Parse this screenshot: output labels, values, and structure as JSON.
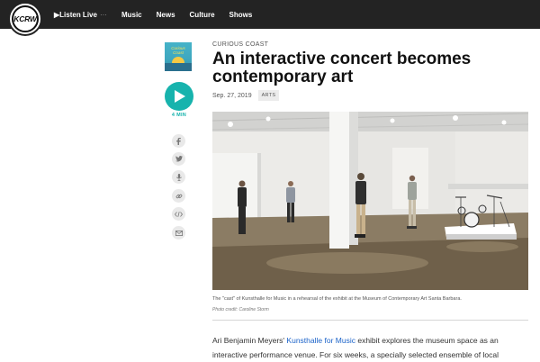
{
  "nav": {
    "logo_text": "KCRW",
    "listen_label": "▶Listen Live",
    "listen_more": "···",
    "items": [
      "Music",
      "News",
      "Culture",
      "Shows"
    ]
  },
  "sidebar": {
    "show_thumbnail_title": "Curious Coast",
    "duration": "4 MIN",
    "share_icons": [
      "facebook-icon",
      "twitter-icon",
      "microphone-icon",
      "link-icon",
      "embed-icon",
      "email-icon"
    ]
  },
  "article": {
    "kicker": "CURIOUS COAST",
    "title": "An interactive concert becomes contemporary art",
    "date": "Sep. 27, 2019",
    "tag": "ARTS",
    "caption": "The \"cast\" of Kunsthalle for Music in a rehearsal of the exhibit at the Museum of Contemporary Art Santa Barbara.",
    "credit": "Photo credit: Caroline Storm",
    "body_before_link": "Ari Benjamin Meyers'",
    "body_link": "Kunsthalle for Music",
    "body_after_link": "exhibit explores the museum space as an interactive performance venue. For six weeks, a specially selected ensemble of local"
  },
  "colors": {
    "nav_bg": "#232323",
    "accent_teal": "#17b3ad",
    "link_blue": "#1b63c9"
  }
}
